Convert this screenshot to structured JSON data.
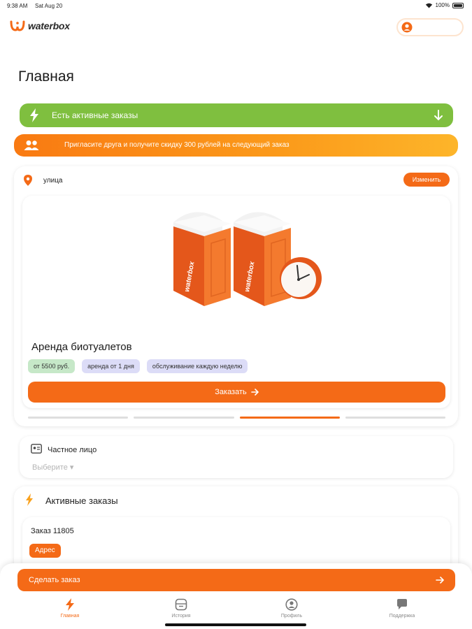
{
  "status_bar": {
    "time": "9:38 AM",
    "date": "Sat Aug 20",
    "battery": "100%"
  },
  "header": {
    "brand": "waterbox",
    "brand_color": "#f46a17",
    "user_icon": "user-circle-icon"
  },
  "page_title": "Главная",
  "active_orders_banner": {
    "text": "Есть активные заказы",
    "color": "#7fbf3f",
    "icon": "lightning-icon",
    "action_icon": "arrow-down-icon"
  },
  "referral_banner": {
    "text": "Пригласите друга и получите скидку 300 рублей на следующий заказ",
    "icon": "group-icon"
  },
  "address": {
    "icon": "location-pin-icon",
    "value": "улица",
    "change_label": "Изменить"
  },
  "service": {
    "title": "Аренда биотуалетов",
    "illustration_brand": "waterbox",
    "tags": [
      {
        "label": "от 5500 руб.",
        "color": "#c6e8c8"
      },
      {
        "label": "аренда от 1 дня",
        "color": "#dcdcf7"
      },
      {
        "label": "обслуживание каждую неделю",
        "color": "#dcdcf7"
      }
    ],
    "order_label": "Заказать",
    "order_icon": "arrow-right-icon"
  },
  "carousel": {
    "pages": 4,
    "active_page": 3
  },
  "entity": {
    "icon": "id-card-icon",
    "label": "Частное лицо",
    "placeholder": "Выберите ▾"
  },
  "active_orders": {
    "title": "Активные заказы",
    "icon": "lightning-icon",
    "items": [
      {
        "number": "Заказ 11805",
        "badge": "Адрес"
      }
    ]
  },
  "make_order": {
    "label": "Сделать заказ",
    "icon": "arrow-right-icon"
  },
  "tabs": [
    {
      "label": "Главная",
      "icon": "lightning-icon",
      "active": true
    },
    {
      "label": "История",
      "icon": "history-icon",
      "active": false
    },
    {
      "label": "Профиль",
      "icon": "profile-icon",
      "active": false
    },
    {
      "label": "Поддержка",
      "icon": "chat-icon",
      "active": false
    }
  ]
}
